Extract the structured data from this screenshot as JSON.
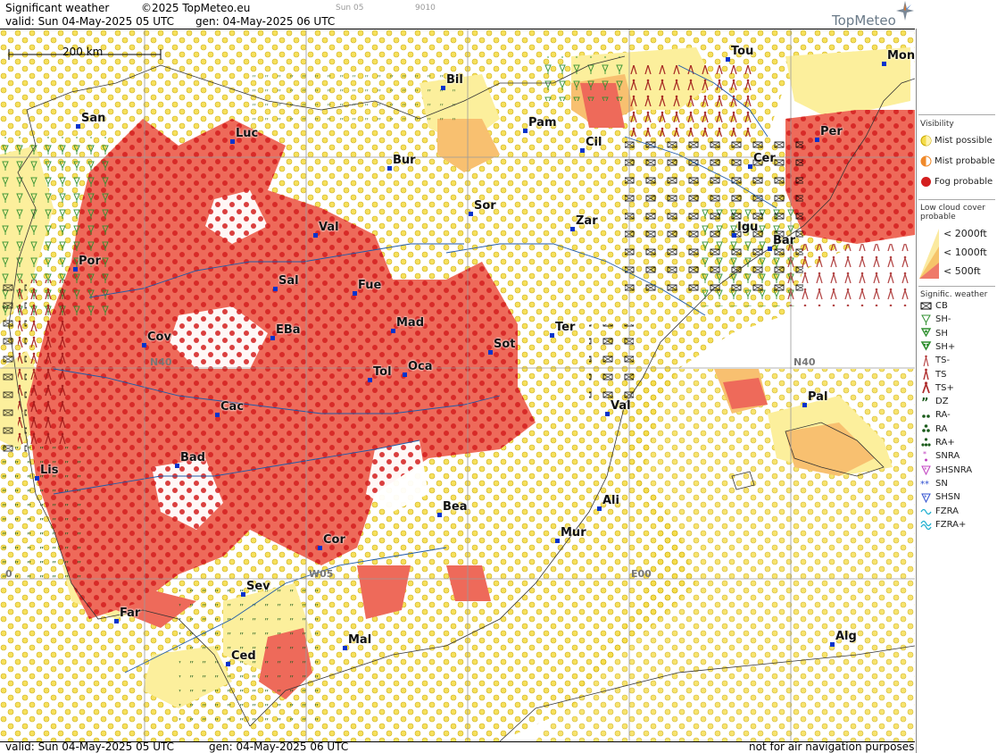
{
  "header": {
    "title": "Significant weather",
    "copyright": "©2025 TopMeteo.eu",
    "day_label": "Sun 05",
    "faint_code": "9010",
    "valid": "valid:  Sun  04-May-2025  05 UTC",
    "generated": "gen:  04-May-2025  06 UTC",
    "logo_text": "TopMeteo"
  },
  "footer": {
    "valid": "valid:  Sun  04-May-2025  05 UTC",
    "generated": "gen:  04-May-2025  06 UTC",
    "disclaimer": "not for air navigation purposes"
  },
  "map": {
    "scale_label": "200 km",
    "gridlines": [
      "N40",
      "E00",
      "W05",
      "0",
      "N40"
    ],
    "cities": [
      {
        "name": "Bil"
      },
      {
        "name": "San"
      },
      {
        "name": "Luc"
      },
      {
        "name": "Pam"
      },
      {
        "name": "Cil"
      },
      {
        "name": "Bur"
      },
      {
        "name": "Tou"
      },
      {
        "name": "Mon"
      },
      {
        "name": "Per"
      },
      {
        "name": "Cer"
      },
      {
        "name": "Sor"
      },
      {
        "name": "Zar"
      },
      {
        "name": "Val"
      },
      {
        "name": "Igu"
      },
      {
        "name": "Bar"
      },
      {
        "name": "Por"
      },
      {
        "name": "Sal"
      },
      {
        "name": "Fue"
      },
      {
        "name": "Mad"
      },
      {
        "name": "Cov"
      },
      {
        "name": "EBa"
      },
      {
        "name": "Ter"
      },
      {
        "name": "Sot"
      },
      {
        "name": "Tol"
      },
      {
        "name": "Oca"
      },
      {
        "name": "Val"
      },
      {
        "name": "Pal"
      },
      {
        "name": "Cac"
      },
      {
        "name": "Bad"
      },
      {
        "name": "Lis"
      },
      {
        "name": "Ali"
      },
      {
        "name": "Bea"
      },
      {
        "name": "Mur"
      },
      {
        "name": "Cor"
      },
      {
        "name": "Sev"
      },
      {
        "name": "Far"
      },
      {
        "name": "Mal"
      },
      {
        "name": "Alg"
      },
      {
        "name": "Ced"
      }
    ],
    "colors": {
      "mist_possible": "#fff3b0",
      "mist_probable": "#f7a34c",
      "fog_probable": "#e03a3a",
      "low_2000": "#fbeaa0",
      "low_1000": "#f6c46a",
      "low_500": "#ef7a6a",
      "thunder": "#b03030",
      "shower": "#2f8f2f",
      "drizzle": "#1c5c1c",
      "city_dot": "#0033cc"
    }
  },
  "legend": {
    "visibility": {
      "title": "Visibility",
      "items": [
        "Mist possible",
        "Mist probable",
        "Fog probable"
      ]
    },
    "low_cloud": {
      "title": "Low cloud cover probable",
      "items": [
        "< 2000ft",
        "< 1000ft",
        "<  500ft"
      ]
    },
    "signif": {
      "title": "Signific. weather",
      "items": [
        "CB",
        "SH-",
        "SH",
        "SH+",
        "TS-",
        "TS",
        "TS+",
        "DZ",
        "RA-",
        "RA",
        "RA+",
        "SNRA",
        "SHSNRA",
        "SN",
        "SHSN",
        "FZRA",
        "FZRA+"
      ]
    }
  }
}
